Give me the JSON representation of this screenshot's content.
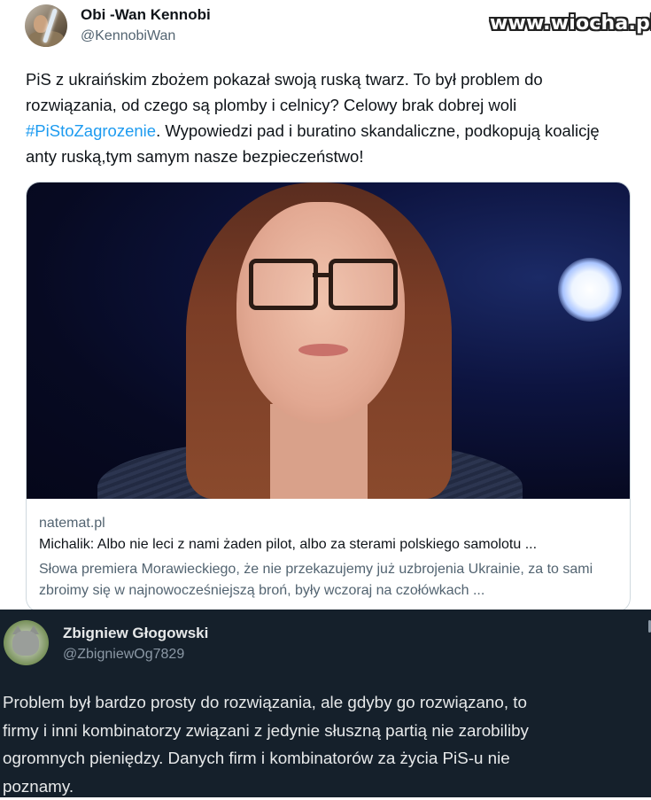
{
  "watermark": "www.wiocha.pl",
  "tweet1": {
    "author_name": "Obi -Wan Kennobi",
    "author_handle": "@KennobiWan",
    "avatar": "lightsaber-avatar",
    "text_before": "PiS z ukraińskim zbożem pokazał swoją ruską twarz. To był problem do rozwiązania, od czego są plomby i celnicy? Celowy brak dobrej woli ",
    "hashtag": "#PiStoZagrozenie",
    "text_after": ". Wypowiedzi pad i buratino skandaliczne, podkopują koalicję anty ruską,tym samym nasze bezpieczeństwo!",
    "link_color": "#1d9bf0"
  },
  "card": {
    "image": "woman-with-glasses-photo",
    "domain": "natemat.pl",
    "title": "Michalik: Albo nie leci z nami żaden pilot, albo za sterami polskiego samolotu ...",
    "description": "Słowa premiera Morawieckiego, że nie przekazujemy już uzbrojenia Ukrainie, za to sami zbroimy się w najnowocześniejszą broń, były wczoraj na czołówkach ..."
  },
  "tweet2": {
    "author_name": "Zbigniew Głogowski",
    "author_handle": "@ZbigniewOg7829",
    "avatar": "cat-avatar",
    "lines": [
      "Problem był bardzo prosty do rozwiązania, ale gdyby go rozwiązano, to",
      "firmy i inni kombinatorzy związani z jedynie słuszną partią nie zarobiliby",
      "ogromnych pieniędzy. Danych firm i kombinatorów za życia PiS-u nie",
      "poznamy."
    ],
    "background": "#15202b"
  }
}
